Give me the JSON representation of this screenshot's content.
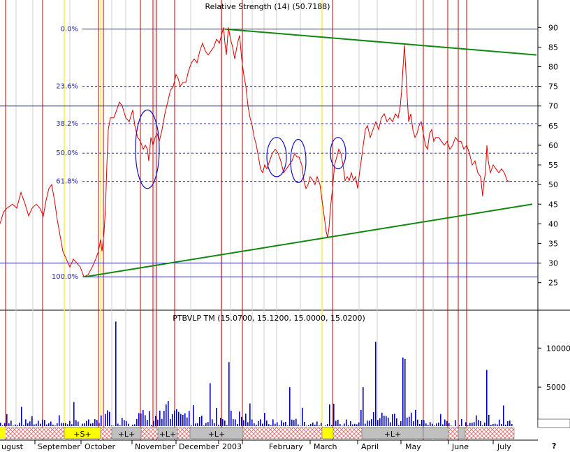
{
  "chart_data": [
    {
      "type": "line",
      "title": "Relative Strength (14) (50.7188)",
      "ylim": [
        18,
        97
      ],
      "y_ticks": [
        25,
        30,
        35,
        40,
        45,
        50,
        55,
        60,
        65,
        70,
        75,
        80,
        85,
        90
      ],
      "y_tick_labels": [
        "25",
        "30",
        "35",
        "40",
        "45",
        "50",
        "55",
        "60",
        "65",
        "70",
        "75",
        "80",
        "85",
        "90"
      ],
      "grid": false,
      "series": [
        {
          "color": "#dd0000",
          "points": [
            [
              0,
              40
            ],
            [
              5,
              43
            ],
            [
              10,
              44
            ],
            [
              18,
              45
            ],
            [
              24,
              44
            ],
            [
              30,
              48
            ],
            [
              36,
              45
            ],
            [
              41,
              42
            ],
            [
              46,
              44
            ],
            [
              52,
              45
            ],
            [
              57,
              44
            ],
            [
              62,
              42
            ],
            [
              66,
              46
            ],
            [
              70,
              49
            ],
            [
              74,
              50
            ],
            [
              78,
              46
            ],
            [
              82,
              41
            ],
            [
              86,
              37
            ],
            [
              90,
              33
            ],
            [
              95,
              31
            ],
            [
              100,
              29
            ],
            [
              105,
              31
            ],
            [
              110,
              30
            ],
            [
              115,
              29
            ],
            [
              120,
              26.5
            ],
            [
              126,
              27
            ],
            [
              132,
              29
            ],
            [
              137,
              31
            ],
            [
              141,
              33
            ],
            [
              144,
              36
            ],
            [
              146,
              33
            ],
            [
              149,
              38
            ],
            [
              151,
              44
            ],
            [
              153,
              55
            ],
            [
              155,
              64
            ],
            [
              158,
              67
            ],
            [
              163,
              67
            ],
            [
              167,
              69
            ],
            [
              171,
              71
            ],
            [
              175,
              70
            ],
            [
              180,
              67
            ],
            [
              185,
              66
            ],
            [
              190,
              69
            ],
            [
              193,
              65
            ],
            [
              197,
              62
            ],
            [
              201,
              61
            ],
            [
              205,
              59
            ],
            [
              208,
              60
            ],
            [
              211,
              59
            ],
            [
              213,
              56
            ],
            [
              216,
              62
            ],
            [
              219,
              60
            ],
            [
              222,
              62
            ],
            [
              225,
              63
            ],
            [
              228,
              61
            ],
            [
              232,
              64
            ],
            [
              236,
              68
            ],
            [
              240,
              71
            ],
            [
              244,
              74
            ],
            [
              248,
              75
            ],
            [
              252,
              78
            ],
            [
              255,
              77
            ],
            [
              258,
              75
            ],
            [
              262,
              76
            ],
            [
              266,
              76
            ],
            [
              270,
              79
            ],
            [
              274,
              81
            ],
            [
              278,
              82
            ],
            [
              282,
              81
            ],
            [
              286,
              84
            ],
            [
              290,
              86
            ],
            [
              294,
              84
            ],
            [
              298,
              83
            ],
            [
              302,
              84
            ],
            [
              306,
              85
            ],
            [
              310,
              87
            ],
            [
              314,
              86
            ],
            [
              317,
              88
            ],
            [
              320,
              90
            ],
            [
              322,
              86
            ],
            [
              324,
              83
            ],
            [
              327,
              90
            ],
            [
              330,
              87
            ],
            [
              333,
              85
            ],
            [
              336,
              82
            ],
            [
              340,
              86
            ],
            [
              343,
              88
            ],
            [
              346,
              82
            ],
            [
              349,
              78
            ],
            [
              352,
              75
            ],
            [
              355,
              70
            ],
            [
              358,
              67
            ],
            [
              361,
              65
            ],
            [
              364,
              62
            ],
            [
              367,
              60
            ],
            [
              370,
              57
            ],
            [
              373,
              54
            ],
            [
              376,
              53
            ],
            [
              379,
              55
            ],
            [
              382,
              54
            ],
            [
              386,
              56
            ],
            [
              390,
              58
            ],
            [
              394,
              59
            ],
            [
              398,
              58
            ],
            [
              402,
              56
            ],
            [
              406,
              53
            ],
            [
              410,
              54
            ],
            [
              414,
              55
            ],
            [
              418,
              56
            ],
            [
              422,
              58
            ],
            [
              425,
              57
            ],
            [
              428,
              57
            ],
            [
              432,
              55
            ],
            [
              435,
              51
            ],
            [
              438,
              49
            ],
            [
              441,
              50
            ],
            [
              444,
              52
            ],
            [
              448,
              51
            ],
            [
              451,
              50
            ],
            [
              454,
              52
            ],
            [
              458,
              50
            ],
            [
              461,
              46
            ],
            [
              464,
              42
            ],
            [
              467,
              38
            ],
            [
              469,
              36.5
            ],
            [
              471,
              39
            ],
            [
              473,
              44
            ],
            [
              476,
              49
            ],
            [
              479,
              55
            ],
            [
              482,
              57
            ],
            [
              485,
              59
            ],
            [
              488,
              58
            ],
            [
              491,
              55
            ],
            [
              494,
              51
            ],
            [
              497,
              52
            ],
            [
              500,
              51
            ],
            [
              503,
              53
            ],
            [
              506,
              51
            ],
            [
              509,
              52
            ],
            [
              512,
              49
            ],
            [
              514,
              52
            ],
            [
              517,
              56
            ],
            [
              520,
              60
            ],
            [
              523,
              64
            ],
            [
              526,
              65
            ],
            [
              530,
              62
            ],
            [
              534,
              64
            ],
            [
              538,
              66
            ],
            [
              542,
              64
            ],
            [
              546,
              67
            ],
            [
              550,
              68
            ],
            [
              554,
              66
            ],
            [
              558,
              67
            ],
            [
              562,
              66
            ],
            [
              566,
              68
            ],
            [
              570,
              67
            ],
            [
              573,
              70
            ],
            [
              575,
              74
            ],
            [
              577,
              80
            ],
            [
              579,
              85.5
            ],
            [
              581,
              79
            ],
            [
              583,
              72
            ],
            [
              585,
              66
            ],
            [
              588,
              68
            ],
            [
              591,
              64
            ],
            [
              594,
              62
            ],
            [
              597,
              63
            ],
            [
              600,
              65
            ],
            [
              603,
              66
            ],
            [
              606,
              63
            ],
            [
              609,
              60
            ],
            [
              612,
              59
            ],
            [
              615,
              63
            ],
            [
              618,
              64
            ],
            [
              621,
              61
            ],
            [
              624,
              62
            ],
            [
              628,
              62
            ],
            [
              632,
              61
            ],
            [
              636,
              60
            ],
            [
              640,
              61
            ],
            [
              644,
              59
            ],
            [
              648,
              60
            ],
            [
              652,
              62
            ],
            [
              656,
              61
            ],
            [
              660,
              61
            ],
            [
              664,
              59
            ],
            [
              668,
              60
            ],
            [
              672,
              58
            ],
            [
              676,
              55
            ],
            [
              680,
              56
            ],
            [
              684,
              53
            ],
            [
              688,
              52
            ],
            [
              691,
              47
            ],
            [
              693,
              51
            ],
            [
              695,
              53
            ],
            [
              697,
              60
            ],
            [
              699,
              56
            ],
            [
              702,
              53
            ],
            [
              706,
              55
            ],
            [
              710,
              54
            ],
            [
              714,
              53
            ],
            [
              718,
              54
            ],
            [
              722,
              53
            ],
            [
              726,
              51
            ],
            [
              730,
              50.7
            ]
          ]
        }
      ],
      "fib_levels": [
        {
          "label": "0.0%",
          "value": 89.6
        },
        {
          "label": "23.6%",
          "value": 75.0
        },
        {
          "label": "38.2%",
          "value": 65.5
        },
        {
          "label": "50.0%",
          "value": 58.0
        },
        {
          "label": "61.8%",
          "value": 50.8
        },
        {
          "label": "100.0%",
          "value": 26.5
        }
      ],
      "horizontal_lines": [
        70,
        30
      ],
      "trendlines": [
        {
          "from": [
            322,
            89.6
          ],
          "to": [
            768,
            83
          ]
        },
        {
          "from": [
            122,
            26.5
          ],
          "to": [
            762,
            45
          ]
        }
      ],
      "ellipses": [
        {
          "cx": 211,
          "cy": 59,
          "rx": 17,
          "ry": 10
        },
        {
          "cx": 396,
          "cy": 57,
          "rx": 14,
          "ry": 5
        },
        {
          "cx": 427,
          "cy": 56,
          "rx": 11,
          "ry": 5.5
        },
        {
          "cx": 484,
          "cy": 58,
          "rx": 11,
          "ry": 4
        }
      ]
    },
    {
      "type": "bar",
      "title": "PTBVLP TM (15.0700, 15.1200, 15.0000, 15.0200)",
      "ylim": [
        0,
        14500
      ],
      "y_ticks": [
        5000,
        10000
      ],
      "y_tick_labels": [
        "5000",
        "10000"
      ],
      "color": "#0000cc"
    }
  ],
  "months": [
    "ugust",
    "September",
    "October",
    "November",
    "December",
    "2003",
    "February",
    "March",
    "April",
    "May",
    "June",
    "July"
  ],
  "bands": [
    {
      "label": "+S+",
      "bg": "#ffff00"
    },
    {
      "label": "+L+",
      "bg": "#c0c0c0"
    },
    {
      "label": "+L+",
      "bg": "#c0c0c0"
    },
    {
      "label": "+L+",
      "bg": "#c0c0c0"
    },
    {
      "label": "+L+",
      "bg": "#c0c0c0"
    }
  ],
  "corner_mark": "?",
  "colors": {
    "price_line": "#dd0000",
    "trendline": "#118811",
    "fib": "#2a2ab0",
    "grid_blue": "#2222aa",
    "red_vline": "#cc0000",
    "yellow_vline": "#ffee44",
    "volume": "#0000cc",
    "hatch": "#e06060"
  }
}
